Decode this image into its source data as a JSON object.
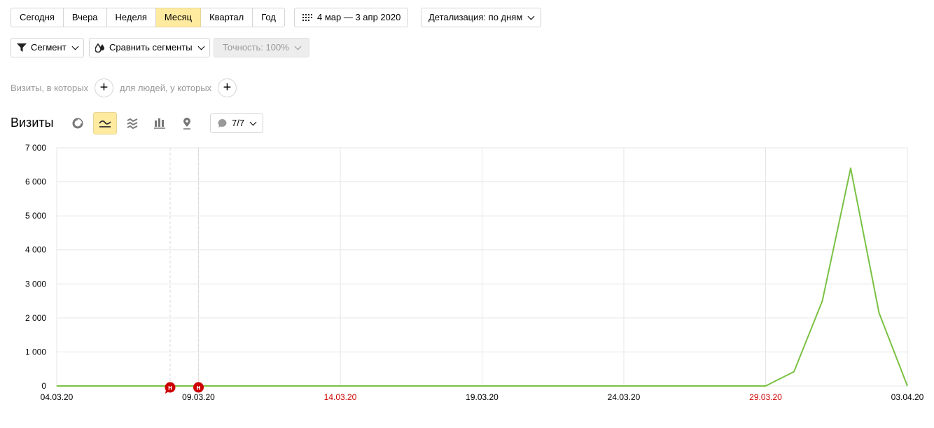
{
  "period_buttons": [
    {
      "label": "Сегодня",
      "active": false
    },
    {
      "label": "Вчера",
      "active": false
    },
    {
      "label": "Неделя",
      "active": false
    },
    {
      "label": "Месяц",
      "active": true
    },
    {
      "label": "Квартал",
      "active": false
    },
    {
      "label": "Год",
      "active": false
    }
  ],
  "date_range": {
    "label": "4 мар — 3 апр 2020",
    "icon": "calendar-icon"
  },
  "detail": {
    "label": "Детализация: по дням"
  },
  "toolbar": {
    "segment_label": "Сегмент",
    "compare_label": "Сравнить сегменты",
    "accuracy_label": "Точность: 100%"
  },
  "filters": {
    "visits_text": "Визиты, в которых",
    "people_text": "для людей, у которых"
  },
  "chart_header": {
    "title": "Визиты",
    "comments_count": "7/7",
    "views": [
      "pie-chart-icon",
      "line-chart-icon",
      "area-chart-icon",
      "bar-chart-icon",
      "map-pin-icon"
    ]
  },
  "colors": {
    "line": "#7ac143",
    "active": "#ffeba0",
    "holiday": "#cc0000",
    "marker": "#cc0000"
  },
  "chart_data": {
    "type": "line",
    "title": "",
    "xlabel": "",
    "ylabel": "",
    "ylim": [
      0,
      7000
    ],
    "yticks": [
      "0",
      "1 000",
      "2 000",
      "3 000",
      "4 000",
      "5 000",
      "6 000",
      "7 000"
    ],
    "xticks": [
      {
        "label": "04.03.20",
        "red": false,
        "index": 0
      },
      {
        "label": "09.03.20",
        "red": false,
        "index": 5
      },
      {
        "label": "14.03.20",
        "red": true,
        "index": 10
      },
      {
        "label": "19.03.20",
        "red": false,
        "index": 15
      },
      {
        "label": "24.03.20",
        "red": false,
        "index": 20
      },
      {
        "label": "29.03.20",
        "red": true,
        "index": 25
      },
      {
        "label": "03.04.20",
        "red": false,
        "index": 30
      }
    ],
    "grid": true,
    "series": [
      {
        "values": [
          0,
          0,
          0,
          0,
          0,
          0,
          0,
          0,
          0,
          0,
          0,
          0,
          0,
          0,
          0,
          0,
          0,
          0,
          0,
          0,
          0,
          0,
          0,
          0,
          0,
          0,
          420,
          2500,
          6400,
          2150,
          0
        ]
      }
    ],
    "annotations": [
      {
        "index": 4,
        "label": "н"
      },
      {
        "index": 5,
        "label": "н"
      }
    ]
  }
}
